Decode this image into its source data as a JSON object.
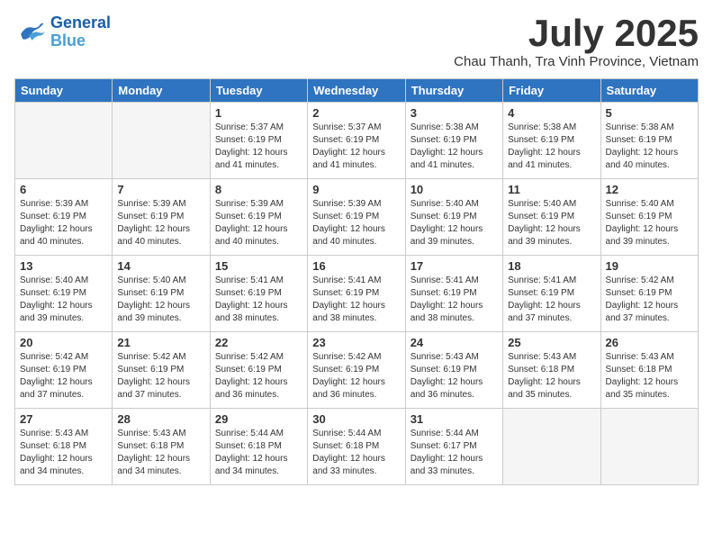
{
  "header": {
    "logo_line1": "General",
    "logo_line2": "Blue",
    "month_title": "July 2025",
    "subtitle": "Chau Thanh, Tra Vinh Province, Vietnam"
  },
  "days_of_week": [
    "Sunday",
    "Monday",
    "Tuesday",
    "Wednesday",
    "Thursday",
    "Friday",
    "Saturday"
  ],
  "weeks": [
    [
      {
        "num": "",
        "info": ""
      },
      {
        "num": "",
        "info": ""
      },
      {
        "num": "1",
        "info": "Sunrise: 5:37 AM\nSunset: 6:19 PM\nDaylight: 12 hours and 41 minutes."
      },
      {
        "num": "2",
        "info": "Sunrise: 5:37 AM\nSunset: 6:19 PM\nDaylight: 12 hours and 41 minutes."
      },
      {
        "num": "3",
        "info": "Sunrise: 5:38 AM\nSunset: 6:19 PM\nDaylight: 12 hours and 41 minutes."
      },
      {
        "num": "4",
        "info": "Sunrise: 5:38 AM\nSunset: 6:19 PM\nDaylight: 12 hours and 41 minutes."
      },
      {
        "num": "5",
        "info": "Sunrise: 5:38 AM\nSunset: 6:19 PM\nDaylight: 12 hours and 40 minutes."
      }
    ],
    [
      {
        "num": "6",
        "info": "Sunrise: 5:39 AM\nSunset: 6:19 PM\nDaylight: 12 hours and 40 minutes."
      },
      {
        "num": "7",
        "info": "Sunrise: 5:39 AM\nSunset: 6:19 PM\nDaylight: 12 hours and 40 minutes."
      },
      {
        "num": "8",
        "info": "Sunrise: 5:39 AM\nSunset: 6:19 PM\nDaylight: 12 hours and 40 minutes."
      },
      {
        "num": "9",
        "info": "Sunrise: 5:39 AM\nSunset: 6:19 PM\nDaylight: 12 hours and 40 minutes."
      },
      {
        "num": "10",
        "info": "Sunrise: 5:40 AM\nSunset: 6:19 PM\nDaylight: 12 hours and 39 minutes."
      },
      {
        "num": "11",
        "info": "Sunrise: 5:40 AM\nSunset: 6:19 PM\nDaylight: 12 hours and 39 minutes."
      },
      {
        "num": "12",
        "info": "Sunrise: 5:40 AM\nSunset: 6:19 PM\nDaylight: 12 hours and 39 minutes."
      }
    ],
    [
      {
        "num": "13",
        "info": "Sunrise: 5:40 AM\nSunset: 6:19 PM\nDaylight: 12 hours and 39 minutes."
      },
      {
        "num": "14",
        "info": "Sunrise: 5:40 AM\nSunset: 6:19 PM\nDaylight: 12 hours and 39 minutes."
      },
      {
        "num": "15",
        "info": "Sunrise: 5:41 AM\nSunset: 6:19 PM\nDaylight: 12 hours and 38 minutes."
      },
      {
        "num": "16",
        "info": "Sunrise: 5:41 AM\nSunset: 6:19 PM\nDaylight: 12 hours and 38 minutes."
      },
      {
        "num": "17",
        "info": "Sunrise: 5:41 AM\nSunset: 6:19 PM\nDaylight: 12 hours and 38 minutes."
      },
      {
        "num": "18",
        "info": "Sunrise: 5:41 AM\nSunset: 6:19 PM\nDaylight: 12 hours and 37 minutes."
      },
      {
        "num": "19",
        "info": "Sunrise: 5:42 AM\nSunset: 6:19 PM\nDaylight: 12 hours and 37 minutes."
      }
    ],
    [
      {
        "num": "20",
        "info": "Sunrise: 5:42 AM\nSunset: 6:19 PM\nDaylight: 12 hours and 37 minutes."
      },
      {
        "num": "21",
        "info": "Sunrise: 5:42 AM\nSunset: 6:19 PM\nDaylight: 12 hours and 37 minutes."
      },
      {
        "num": "22",
        "info": "Sunrise: 5:42 AM\nSunset: 6:19 PM\nDaylight: 12 hours and 36 minutes."
      },
      {
        "num": "23",
        "info": "Sunrise: 5:42 AM\nSunset: 6:19 PM\nDaylight: 12 hours and 36 minutes."
      },
      {
        "num": "24",
        "info": "Sunrise: 5:43 AM\nSunset: 6:19 PM\nDaylight: 12 hours and 36 minutes."
      },
      {
        "num": "25",
        "info": "Sunrise: 5:43 AM\nSunset: 6:18 PM\nDaylight: 12 hours and 35 minutes."
      },
      {
        "num": "26",
        "info": "Sunrise: 5:43 AM\nSunset: 6:18 PM\nDaylight: 12 hours and 35 minutes."
      }
    ],
    [
      {
        "num": "27",
        "info": "Sunrise: 5:43 AM\nSunset: 6:18 PM\nDaylight: 12 hours and 34 minutes."
      },
      {
        "num": "28",
        "info": "Sunrise: 5:43 AM\nSunset: 6:18 PM\nDaylight: 12 hours and 34 minutes."
      },
      {
        "num": "29",
        "info": "Sunrise: 5:44 AM\nSunset: 6:18 PM\nDaylight: 12 hours and 34 minutes."
      },
      {
        "num": "30",
        "info": "Sunrise: 5:44 AM\nSunset: 6:18 PM\nDaylight: 12 hours and 33 minutes."
      },
      {
        "num": "31",
        "info": "Sunrise: 5:44 AM\nSunset: 6:17 PM\nDaylight: 12 hours and 33 minutes."
      },
      {
        "num": "",
        "info": ""
      },
      {
        "num": "",
        "info": ""
      }
    ]
  ]
}
